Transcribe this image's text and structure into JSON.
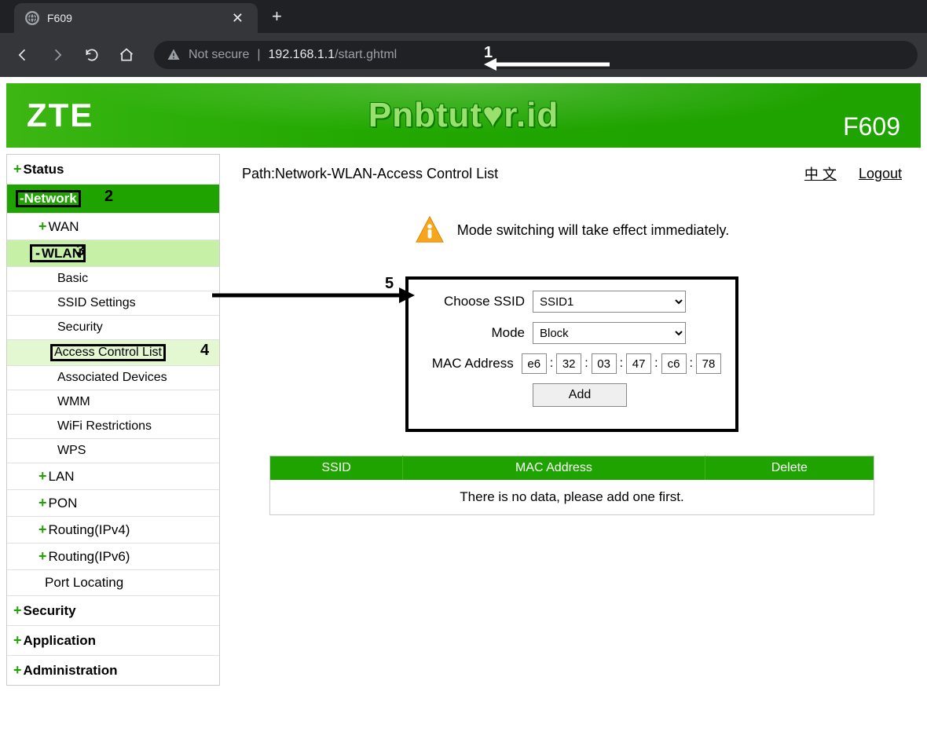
{
  "browser": {
    "tab_title": "F609",
    "not_secure": "Not secure",
    "url_host": "192.168.1.1",
    "url_path": "/start.ghtml"
  },
  "banner": {
    "brand": "ZTE",
    "watermark": "Pnbtut♥r.id",
    "model": "F609"
  },
  "sidebar": {
    "status": "Status",
    "network": "Network",
    "wan": "WAN",
    "wlan": "WLAN",
    "wlan_items": {
      "basic": "Basic",
      "ssid_settings": "SSID Settings",
      "security": "Security",
      "acl": "Access Control List",
      "assoc": "Associated Devices",
      "wmm": "WMM",
      "wifi_restr": "WiFi Restrictions",
      "wps": "WPS"
    },
    "lan": "LAN",
    "pon": "PON",
    "routing4": "Routing(IPv4)",
    "routing6": "Routing(IPv6)",
    "port_loc": "Port Locating",
    "security_cat": "Security",
    "application": "Application",
    "administration": "Administration"
  },
  "content": {
    "path_label": "Path:",
    "path_value": "Network-WLAN-Access Control List",
    "lang_link": "中 文",
    "logout": "Logout",
    "notice": "Mode switching will take effect immediately.",
    "form": {
      "ssid_label": "Choose SSID",
      "ssid_value": "SSID1",
      "mode_label": "Mode",
      "mode_value": "Block",
      "mac_label": "MAC Address",
      "mac": [
        "e6",
        "32",
        "03",
        "47",
        "c6",
        "78"
      ],
      "add_btn": "Add"
    },
    "table": {
      "col_ssid": "SSID",
      "col_mac": "MAC Address",
      "col_delete": "Delete",
      "empty": "There is no data, please add one first."
    }
  },
  "annotations": {
    "a1": "1",
    "a2": "2",
    "a3": "3",
    "a4": "4",
    "a5": "5"
  }
}
